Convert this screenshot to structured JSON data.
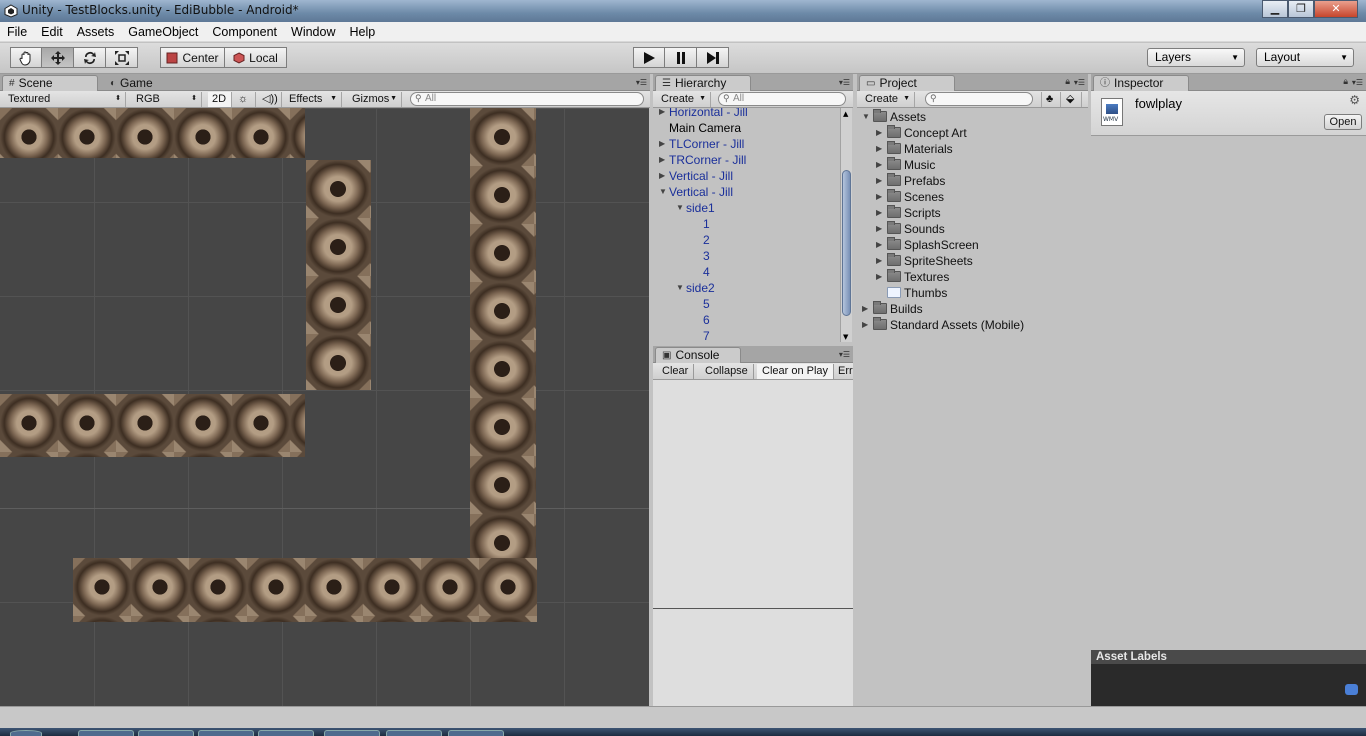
{
  "window": {
    "title": "Unity - TestBlocks.unity - EdiBubble - Android*",
    "minimize_label": "▁",
    "maximize_label": "❐",
    "close_label": "✕"
  },
  "menu": [
    "File",
    "Edit",
    "Assets",
    "GameObject",
    "Component",
    "Window",
    "Help"
  ],
  "toolbar": {
    "tools": [
      "hand-icon",
      "move-icon",
      "rotate-icon",
      "scale-icon"
    ],
    "pivot_mode": "Center",
    "pivot_space": "Local",
    "play_controls": [
      "play-icon",
      "pause-icon",
      "step-icon"
    ],
    "layers_label": "Layers",
    "layout_label": "Layout"
  },
  "scene_panel": {
    "tabs": [
      "Scene",
      "Game"
    ],
    "shading": "Textured",
    "render_mode": "RGB",
    "mode_2d": "2D",
    "effects": "Effects",
    "gizmos": "Gizmos",
    "search_placeholder": "All"
  },
  "hierarchy": {
    "tab": "Hierarchy",
    "create": "Create",
    "search_placeholder": "All",
    "items": [
      {
        "label": "Horizontal - Jill",
        "blue": true,
        "expand": "collapsed",
        "depth": 0
      },
      {
        "label": "Main Camera",
        "blue": false,
        "expand": "none",
        "depth": 0
      },
      {
        "label": "TLCorner - Jill",
        "blue": true,
        "expand": "collapsed",
        "depth": 0
      },
      {
        "label": "TRCorner - Jill",
        "blue": true,
        "expand": "collapsed",
        "depth": 0
      },
      {
        "label": "Vertical - Jill",
        "blue": true,
        "expand": "collapsed",
        "depth": 0
      },
      {
        "label": "Vertical - Jill",
        "blue": true,
        "expand": "expanded",
        "depth": 0
      },
      {
        "label": "side1",
        "blue": true,
        "expand": "expanded",
        "depth": 1
      },
      {
        "label": "1",
        "blue": true,
        "expand": "none",
        "depth": 2
      },
      {
        "label": "2",
        "blue": true,
        "expand": "none",
        "depth": 2
      },
      {
        "label": "3",
        "blue": true,
        "expand": "none",
        "depth": 2
      },
      {
        "label": "4",
        "blue": true,
        "expand": "none",
        "depth": 2
      },
      {
        "label": "side2",
        "blue": true,
        "expand": "expanded",
        "depth": 1
      },
      {
        "label": "5",
        "blue": true,
        "expand": "none",
        "depth": 2
      },
      {
        "label": "6",
        "blue": true,
        "expand": "none",
        "depth": 2
      },
      {
        "label": "7",
        "blue": true,
        "expand": "none",
        "depth": 2
      }
    ]
  },
  "console": {
    "tab": "Console",
    "buttons": [
      "Clear",
      "Collapse",
      "Clear on Play",
      "Err"
    ]
  },
  "project": {
    "tab": "Project",
    "create": "Create",
    "root": "Assets",
    "folders": [
      "Concept Art",
      "Materials",
      "Music",
      "Prefabs",
      "Scenes",
      "Scripts",
      "Sounds",
      "SplashScreen",
      "SpriteSheets",
      "Textures"
    ],
    "asset_file": "Thumbs",
    "other_roots": [
      "Builds",
      "Standard Assets (Mobile)"
    ]
  },
  "inspector": {
    "tab": "Inspector",
    "asset_name": "fowlplay",
    "file_type_badge": "WMV",
    "open_button": "Open",
    "asset_labels_header": "Asset Labels"
  }
}
